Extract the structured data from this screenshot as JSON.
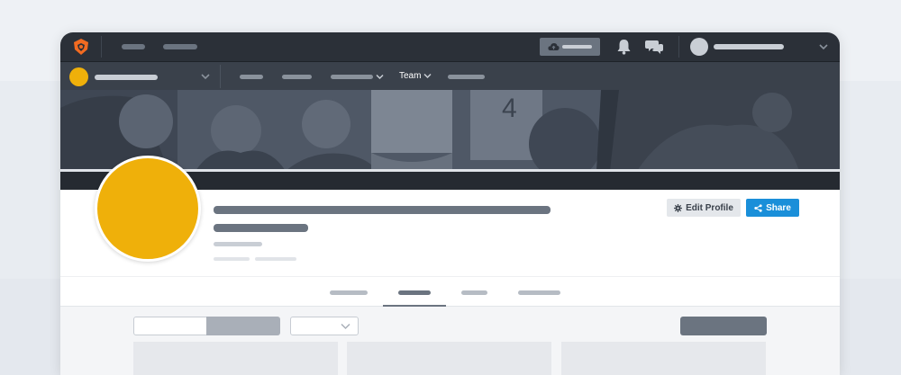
{
  "colors": {
    "topbar": "#2b3038",
    "subbar": "#3a414b",
    "avatar": "#efb00a",
    "share_button": "#1a8fd9",
    "placeholder_dark": "#6b7480",
    "placeholder_light": "#c9ced5"
  },
  "icons": {
    "logo": "brand-logo-icon",
    "upload": "cloud-upload-icon",
    "bell": "bell-icon",
    "chat": "chat-icon",
    "account_chevron": "chevron-down-icon",
    "team_chevron": "chevron-down-icon",
    "edit": "gear-icon",
    "share": "share-icon"
  },
  "subnav": {
    "team_label": "Team"
  },
  "profile": {
    "edit_label": "Edit Profile",
    "share_label": "Share"
  }
}
